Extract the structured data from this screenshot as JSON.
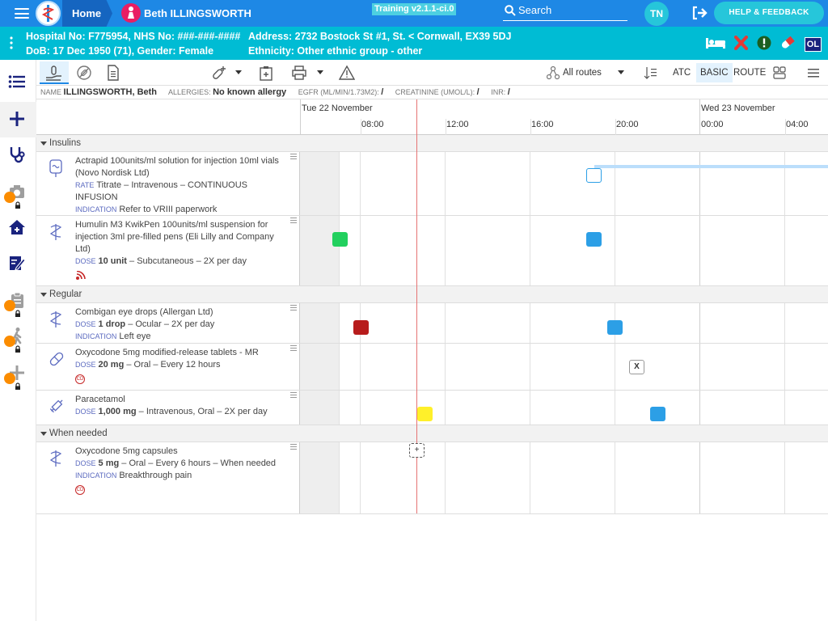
{
  "header": {
    "home_label": "Home",
    "patient_name": "Beth ILLINGSWORTH",
    "training": "Training v2.1.1-ci.0",
    "search_label": "Search",
    "user_initials": "TN",
    "help_label": "HELP & FEEDBACK"
  },
  "banner": {
    "hospital": "Hospital No: F775954, NHS No: ###-###-####",
    "dob": "DoB: 17 Dec 1950 (71), Gender: Female",
    "address": "Address: 2732 Bostock St #1, St. < Cornwall, EX39 5DJ",
    "ethnicity": "Ethnicity: Other ethnic group - other",
    "ol_badge": "OL"
  },
  "toolbar": {
    "routes_label": "All routes",
    "atc_label": "ATC",
    "basic_label": "BASIC",
    "route_label": "ROUTE"
  },
  "info": {
    "name_label": "NAME",
    "name_value": "ILLINGSWORTH, Beth",
    "allergies_label": "ALLERGIES:",
    "allergies_value": "No known allergy",
    "egfr_label": "EGFR (ML/MIN/1.73M2):",
    "egfr_value": "/",
    "creatinine_label": "CREATININE (UMOL/L):",
    "creatinine_value": "/",
    "inr_label": "INR:",
    "inr_value": "/"
  },
  "timeline": {
    "day1": "Tue 22 November",
    "day2": "Wed 23 November",
    "ticks": [
      "08:00",
      "12:00",
      "16:00",
      "20:00",
      "00:00",
      "04:00"
    ]
  },
  "sections": {
    "insulins": "Insulins",
    "regular": "Regular",
    "when_needed": "When needed"
  },
  "meds": [
    {
      "name": "Actrapid 100units/ml solution for injection 10ml vials (Novo Nordisk Ltd)",
      "detail_label": "RATE",
      "detail": "Titrate – Intravenous – CONTINUOUS INFUSION",
      "indication_label": "INDICATION",
      "indication": "Refer to VRIII paperwork"
    },
    {
      "name": "Humulin M3 KwikPen 100units/ml suspension for injection 3ml pre-filled pens (Eli Lilly and Company Ltd)",
      "detail_label": "DOSE",
      "dose": "10 unit",
      "detail": "– Subcutaneous – 2X per day"
    },
    {
      "name": "Combigan eye drops (Allergan Ltd)",
      "detail_label": "DOSE",
      "dose": "1 drop",
      "detail": "– Ocular – 2X per day",
      "indication_label": "INDICATION",
      "indication": "Left eye"
    },
    {
      "name": "Oxycodone 5mg modified-release tablets - MR",
      "detail_label": "DOSE",
      "dose": "20 mg",
      "detail": "– Oral – Every 12 hours",
      "badge": "CD"
    },
    {
      "name": "Paracetamol",
      "detail_label": "DOSE",
      "dose": "1,000 mg",
      "detail": "– Intravenous, Oral – 2X per day"
    },
    {
      "name": "Oxycodone 5mg capsules",
      "detail_label": "DOSE",
      "dose": "5 mg",
      "detail": "– Oral – Every 6 hours – When needed",
      "indication_label": "INDICATION",
      "indication": "Breakthrough pain",
      "badge": "CD"
    }
  ],
  "markers": {
    "x_label": "X",
    "plus_label": "+"
  },
  "colors": {
    "given": "#22d05e",
    "scheduled": "#2c9fe6",
    "missed": "#b71c1c",
    "due": "#fff02a",
    "now_line": "#e57373"
  }
}
